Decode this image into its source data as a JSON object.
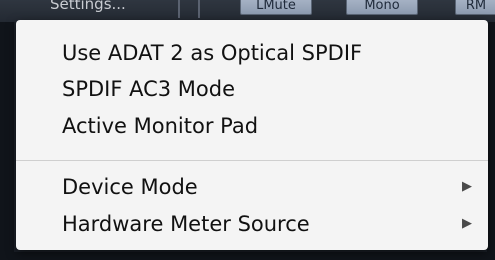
{
  "toolbar": {
    "settings_label": "Settings...",
    "buttons": [
      "LMute",
      "Mono",
      "RM"
    ]
  },
  "menu": {
    "items": [
      {
        "label": "Use ADAT 2 as Optical SPDIF"
      },
      {
        "label": "SPDIF AC3 Mode"
      },
      {
        "label": "Active Monitor Pad"
      },
      {
        "label": "Device Mode",
        "submenu_arrow": "▶"
      },
      {
        "label": "Hardware Meter Source",
        "submenu_arrow": "▶"
      }
    ]
  }
}
